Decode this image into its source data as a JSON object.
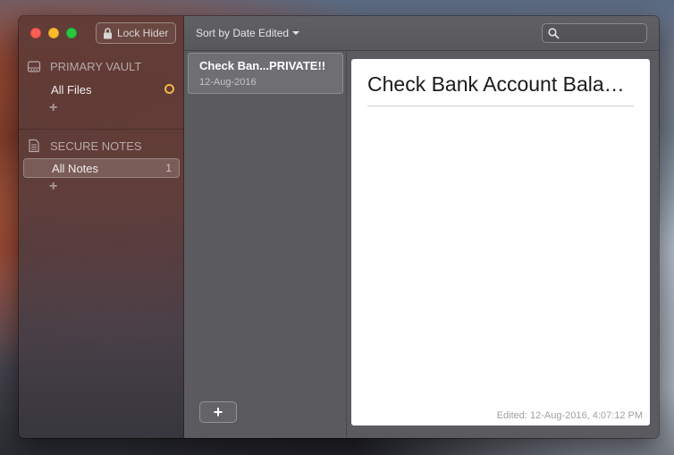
{
  "window": {
    "lock_button": "Lock Hider"
  },
  "sidebar": {
    "vault_header": "PRIMARY VAULT",
    "vault_items": [
      {
        "label": "All Files"
      }
    ],
    "notes_header": "SECURE NOTES",
    "notes_items": [
      {
        "label": "All Notes",
        "count": "1"
      }
    ],
    "add_glyph": "+"
  },
  "toolbar": {
    "sort_label": "Sort by Date Edited",
    "search_placeholder": ""
  },
  "notes_list": [
    {
      "title": "Check Ban...PRIVATE!!",
      "date": "12-Aug-2016"
    }
  ],
  "add_note_glyph": "+",
  "editor": {
    "title": "Check Bank Account Bala…",
    "edited": "Edited: 12-Aug-2016, 4:07:12 PM"
  },
  "colors": {
    "accent_ring": "#f1b64a",
    "close": "#fc5f57",
    "minimize": "#fdbc2e",
    "maximize": "#28c840"
  }
}
